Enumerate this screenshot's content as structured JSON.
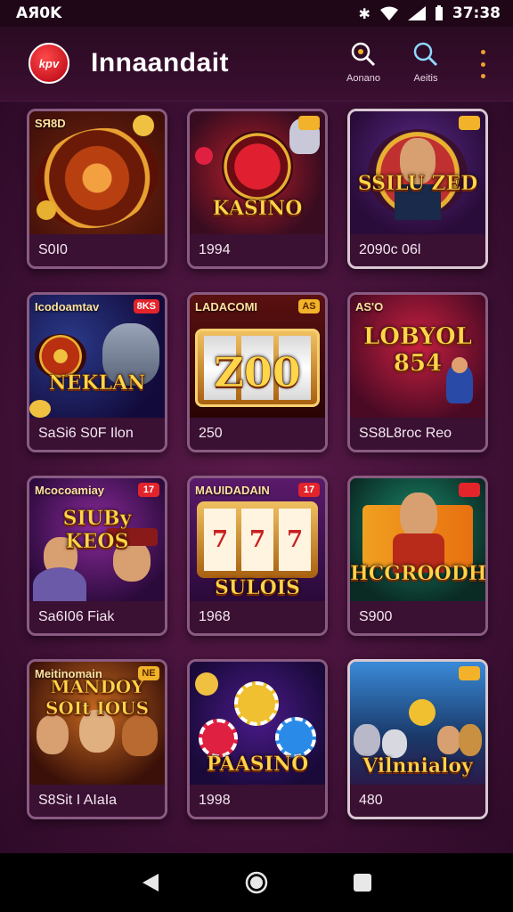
{
  "status_bar": {
    "time_left": "AЯ0K",
    "time_right": "37:38"
  },
  "header": {
    "logo_text": "kpv",
    "title": "Innaandait",
    "actions": [
      {
        "label": "Aonano",
        "icon": "search-icon"
      },
      {
        "label": "Aeitis",
        "icon": "search-icon"
      }
    ],
    "menu_icon": "more-vert-icon"
  },
  "games": [
    {
      "tag": "SЯ8D",
      "badge": "",
      "title": "",
      "footer": "S0I0",
      "theme": "roulette"
    },
    {
      "tag": "",
      "badge": "",
      "title": "KASINO",
      "footer": "1994",
      "theme": "kasino"
    },
    {
      "tag": "",
      "badge": "",
      "title": "SSILU ZED",
      "footer": "2090ᴄ 06l",
      "theme": "portrait"
    },
    {
      "tag": "Icodoamtav",
      "badge": "8KS",
      "title": "NEKLAN",
      "footer": "SaSi6 S0F Ilon",
      "theme": "wolf"
    },
    {
      "tag": "LADACOMI",
      "badge": "AS",
      "title": "Z00",
      "footer": "250",
      "theme": "slots"
    },
    {
      "tag": "AS'O",
      "badge": "",
      "title": "LOBYOL 854",
      "footer": "SS8L8roc Reo",
      "theme": "lobyol"
    },
    {
      "tag": "Mcocoamiay",
      "badge": "17",
      "title": "SIUBy KEOS",
      "footer": "Sa6I06 Fiak",
      "theme": "characters"
    },
    {
      "tag": "MAUIDADAIN",
      "badge": "17",
      "title": "SULOIS",
      "footer": "1968",
      "theme": "sevens"
    },
    {
      "tag": "",
      "badge": "",
      "title": "HCGROODH",
      "footer": "S900",
      "theme": "dtslot"
    },
    {
      "tag": "Meitinomain",
      "badge": "NE",
      "title": "MANDOY SOIt IOUS",
      "footer": "S8Sit I AIaIa",
      "theme": "group"
    },
    {
      "tag": "",
      "badge": "",
      "title": "PAASINO",
      "footer": "1998",
      "theme": "chips"
    },
    {
      "tag": "",
      "badge": "",
      "title": "Vilnnialoy",
      "footer": "480",
      "theme": "animals"
    }
  ],
  "nav": {
    "back": "back-icon",
    "home": "home-icon",
    "recents": "recents-icon"
  },
  "colors": {
    "background": "#3a0d2e",
    "accent": "#f2b229",
    "card_border": "#8a5b82"
  }
}
